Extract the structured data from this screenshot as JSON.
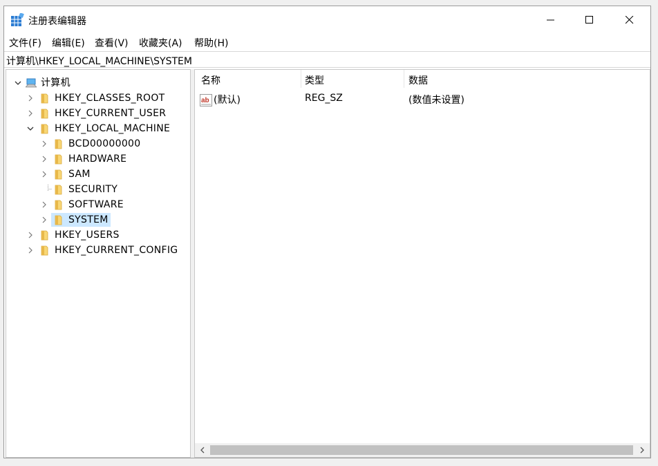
{
  "window": {
    "title": "注册表编辑器"
  },
  "menu": [
    "文件(F)",
    "编辑(E)",
    "查看(V)",
    "收藏夹(A)",
    "帮助(H)"
  ],
  "address": "计算机\\HKEY_LOCAL_MACHINE\\SYSTEM",
  "tree": {
    "root": "计算机",
    "hives": [
      "HKEY_CLASSES_ROOT",
      "HKEY_CURRENT_USER",
      "HKEY_LOCAL_MACHINE",
      "HKEY_USERS",
      "HKEY_CURRENT_CONFIG"
    ],
    "hklm_children": [
      "BCD00000000",
      "HARDWARE",
      "SAM",
      "SECURITY",
      "SOFTWARE",
      "SYSTEM"
    ],
    "selected": "SYSTEM"
  },
  "list": {
    "columns": [
      "名称",
      "类型",
      "数据"
    ],
    "rows": [
      {
        "name": "(默认)",
        "type": "REG_SZ",
        "data": "(数值未设置)"
      }
    ]
  },
  "colors": {
    "selection": "#cce8ff",
    "folder": "#f8d775",
    "accent": "#0078d7"
  }
}
